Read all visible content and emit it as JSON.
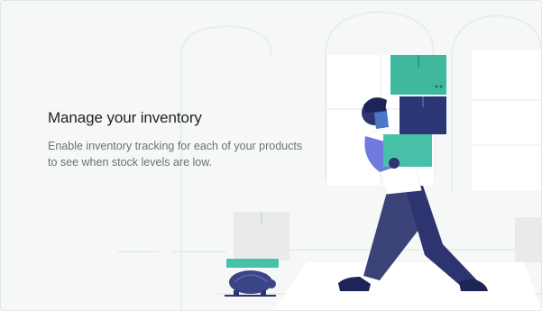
{
  "empty_state": {
    "heading": "Manage your inventory",
    "description_line1": "Enable inventory tracking for each of your products",
    "description_line2": "to see when stock levels are low."
  },
  "colors": {
    "background": "#f6f8f8",
    "heading_text": "#202223",
    "body_text": "#6d7175",
    "teal_box": "#3fb89e",
    "navy_box": "#2b3674",
    "purple_accent": "#6f7adf"
  },
  "icons": {
    "illustration": "person-carrying-boxes-illustration",
    "turtle": "turtle-icon"
  }
}
